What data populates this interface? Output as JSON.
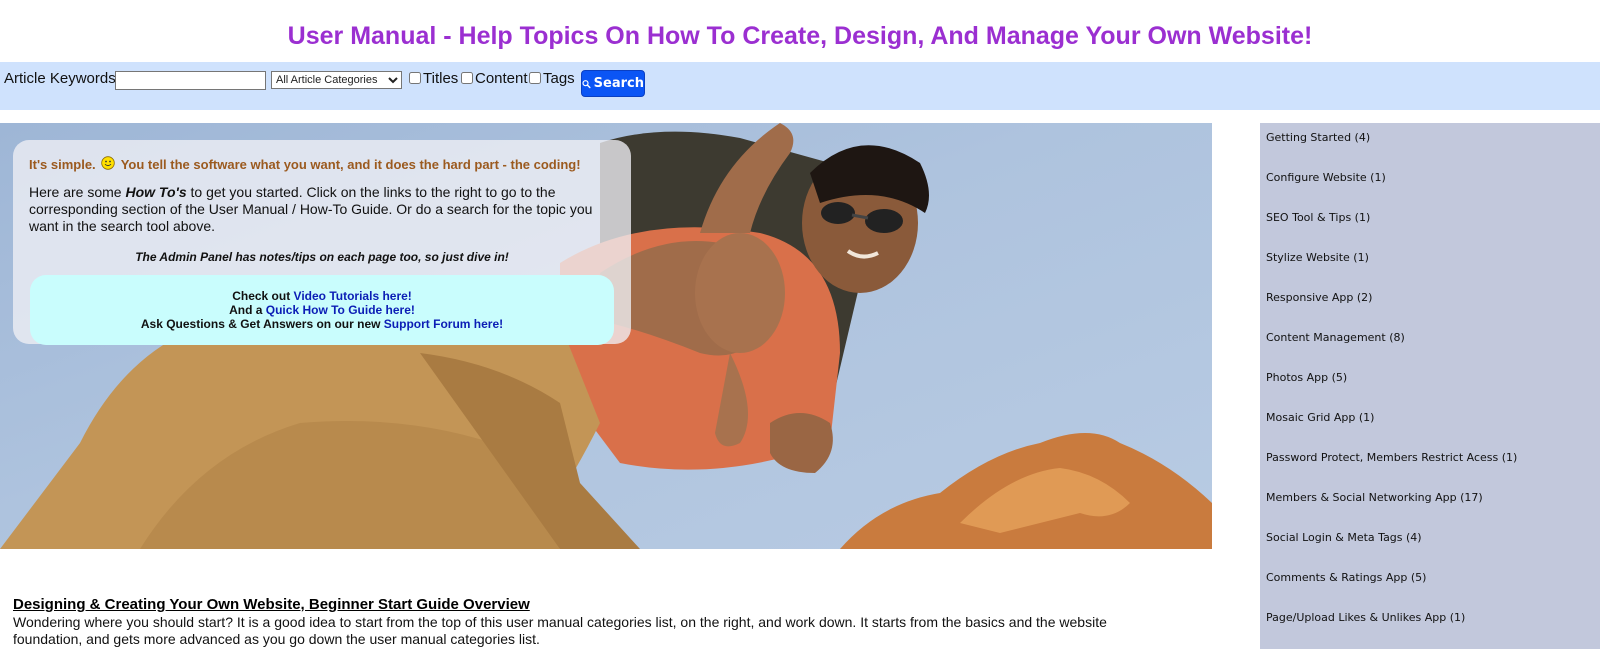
{
  "header": {
    "title": "User Manual - Help Topics On How To Create, Design, And Manage Your Own Website!"
  },
  "search": {
    "keywords_label": "Article Keywords",
    "keywords_value": "",
    "category_selected": "All Article Categories",
    "checkbox_titles": "Titles",
    "checkbox_content": "Content",
    "checkbox_tags": "Tags",
    "button_label": "Search"
  },
  "intro": {
    "simple_part1": "It's simple.",
    "simple_part2": "You tell the software what you want, and it does the hard part - the coding!",
    "howto_prefix": "Here are some ",
    "howto_emph": "How To's",
    "howto_suffix": " to get you started.  Click on the links to the right to go to the corresponding section of the User Manual / How-To Guide. Or do a search for the topic you want in the search tool above.",
    "admin_note": "The Admin Panel has notes/tips on each page too, so just dive in!",
    "line1_text": "Check out ",
    "line1_link": "Video Tutorials here!",
    "line2_text": "And a ",
    "line2_link": "Quick How To Guide here!",
    "line3_text": "Ask Questions & Get Answers on our new ",
    "line3_link": "Support Forum here!"
  },
  "sidebar": {
    "categories": [
      "Getting Started (4)",
      "Configure Website (1)",
      "SEO Tool & Tips (1)",
      "Stylize Website (1)",
      "Responsive App (2)",
      "Content Management (8)",
      "Photos App (5)",
      "Mosaic Grid App (1)",
      "Password Protect, Members Restrict Acess (1)",
      "Members & Social Networking App (17)",
      "Social Login & Meta Tags (4)",
      "Comments & Ratings App (5)",
      "Page/Upload Likes & Unlikes App (1)"
    ]
  },
  "article": {
    "title": "Designing & Creating Your Own Website, Beginner Start Guide Overview",
    "body": "Wondering where you should start?  It is a good idea to start from the top of this user manual categories list, on the right, and work down.  It starts from the basics and the website foundation, and gets more advanced as you go down the user manual categories list."
  },
  "colors": {
    "title": "#9b2fd1",
    "search_bar_bg": "#cfe2fd",
    "search_button": "#0b55f5",
    "sidebar_bg": "#c2c8dc",
    "links_box_bg": "#c9fdfd",
    "link": "#0b1db5"
  },
  "icons": {
    "search_button_icon": "magnifier-icon",
    "smiley": "smiley-icon"
  }
}
